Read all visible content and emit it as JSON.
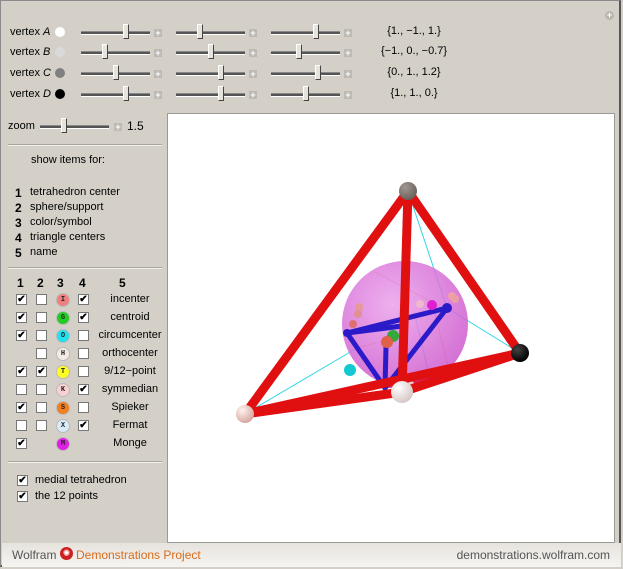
{
  "vertices": [
    {
      "label_prefix": "vertex ",
      "letter": "A",
      "dot_color": "#ffffff",
      "sliders": [
        0.65,
        0.35,
        0.65
      ],
      "value": "{1., −1., 1.}"
    },
    {
      "label_prefix": "vertex ",
      "letter": "B",
      "dot_color": "#d9d9d9",
      "sliders": [
        0.35,
        0.5,
        0.4
      ],
      "value": "{−1., 0., −0.7}"
    },
    {
      "label_prefix": "vertex ",
      "letter": "C",
      "dot_color": "#808080",
      "sliders": [
        0.5,
        0.65,
        0.68
      ],
      "value": "{0., 1., 1.2}"
    },
    {
      "label_prefix": "vertex ",
      "letter": "D",
      "dot_color": "#000000",
      "sliders": [
        0.65,
        0.65,
        0.5
      ],
      "value": "{1., 1., 0.}"
    }
  ],
  "zoom": {
    "label": "zoom",
    "fraction": 0.35,
    "value": "1.5"
  },
  "show_items": {
    "title": "show items for:",
    "legend": [
      {
        "num": "1",
        "text": "tetrahedron center"
      },
      {
        "num": "2",
        "text": "sphere/support"
      },
      {
        "num": "3",
        "text": "color/symbol"
      },
      {
        "num": "4",
        "text": "triangle centers"
      },
      {
        "num": "5",
        "text": "name"
      }
    ],
    "headers": [
      "1",
      "2",
      "3",
      "4",
      "5"
    ]
  },
  "centers": [
    {
      "name": "incenter",
      "symbol": "I",
      "color": "#f08080",
      "c1": true,
      "c2": false,
      "c4": true,
      "has1": true,
      "has2": true,
      "has4": true
    },
    {
      "name": "centroid",
      "symbol": "G",
      "color": "#22cc22",
      "c1": true,
      "c2": false,
      "c4": true,
      "has1": true,
      "has2": true,
      "has4": true
    },
    {
      "name": "circumcenter",
      "symbol": "O",
      "color": "#22e0f0",
      "c1": true,
      "c2": false,
      "c4": false,
      "has1": true,
      "has2": true,
      "has4": true
    },
    {
      "name": "orthocenter",
      "symbol": "H",
      "color": "#f4ece4",
      "c1": false,
      "c2": false,
      "c4": false,
      "has1": false,
      "has2": true,
      "has4": true
    },
    {
      "name": "9/12−point",
      "symbol": "T",
      "color": "#ffff22",
      "c1": true,
      "c2": true,
      "c4": false,
      "has1": true,
      "has2": true,
      "has4": true
    },
    {
      "name": "symmedian",
      "symbol": "K",
      "color": "#f8d0d0",
      "c1": false,
      "c2": false,
      "c4": true,
      "has1": true,
      "has2": true,
      "has4": true
    },
    {
      "name": "Spieker",
      "symbol": "S",
      "color": "#f08020",
      "c1": true,
      "c2": false,
      "c4": false,
      "has1": true,
      "has2": true,
      "has4": true
    },
    {
      "name": "Fermat",
      "symbol": "X",
      "color": "#d8ecf8",
      "c1": false,
      "c2": false,
      "c4": true,
      "has1": true,
      "has2": true,
      "has4": true
    },
    {
      "name": "Monge",
      "symbol": "M",
      "color": "#e020e0",
      "c1": true,
      "c2": false,
      "c4": false,
      "has1": true,
      "has2": false,
      "has4": false
    }
  ],
  "options": [
    {
      "label": "medial tetrahedron",
      "checked": true
    },
    {
      "label": "the 12 points",
      "checked": true
    }
  ],
  "footer": {
    "brand1": "Wolfram",
    "brand2": "Demonstrations Project",
    "url": "demonstrations.wolfram.com",
    "brand_color": "#d86c1a"
  },
  "scene": {
    "edge_color": "#e01010",
    "medial_color": "#2a1ac8",
    "sphere_color": "#d86ad8"
  }
}
